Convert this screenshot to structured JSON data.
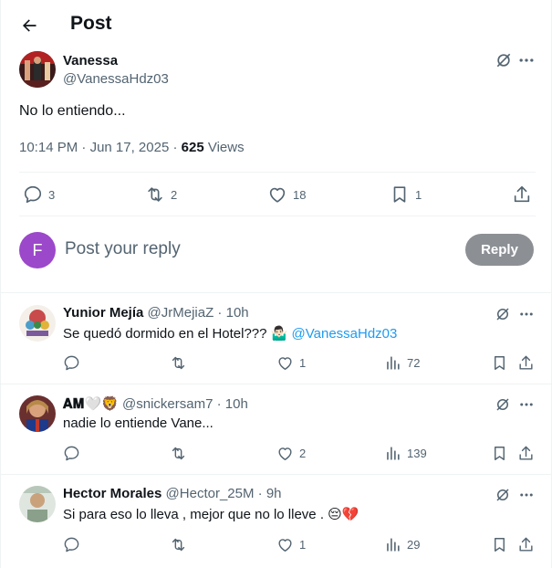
{
  "header": {
    "title": "Post"
  },
  "main_tweet": {
    "author_name": "Vanessa",
    "author_handle": "@VanessaHdz03",
    "text": "No lo entiendo...",
    "time": "10:14 PM",
    "date": "Jun 17, 2025",
    "views_count": "625",
    "views_label": "Views",
    "stats": {
      "replies": "3",
      "reposts": "2",
      "likes": "18",
      "bookmarks": "1"
    }
  },
  "reply_composer": {
    "avatar_letter": "F",
    "placeholder": "Post your reply",
    "button_label": "Reply"
  },
  "replies": [
    {
      "name": "Yunior Mejía",
      "handle": "@JrMejiaZ",
      "time": "10h",
      "text": "Se quedó dormido en el Hotel??? 🤷🏻‍♂️",
      "mention": "@VanessaHdz03",
      "stats": {
        "replies": "",
        "reposts": "",
        "likes": "1",
        "views": "72"
      }
    },
    {
      "name": "𝐀𝐌🤍🦁",
      "handle": "@snickersam7",
      "time": "10h",
      "text": "nadie lo entiende Vane...",
      "mention": "",
      "stats": {
        "replies": "",
        "reposts": "",
        "likes": "2",
        "views": "139"
      }
    },
    {
      "name": "Hector Morales",
      "handle": "@Hector_25M",
      "time": "9h",
      "text": "Si para eso lo lleva , mejor que no lo lleve . 😔💔",
      "mention": "",
      "stats": {
        "replies": "",
        "reposts": "",
        "likes": "1",
        "views": "29"
      }
    }
  ],
  "colors": {
    "text": "#0f1419",
    "muted": "#536471",
    "link": "#1d9bf0",
    "reply_button": "#8c9095",
    "composer_avatar": "#9c48ca"
  }
}
